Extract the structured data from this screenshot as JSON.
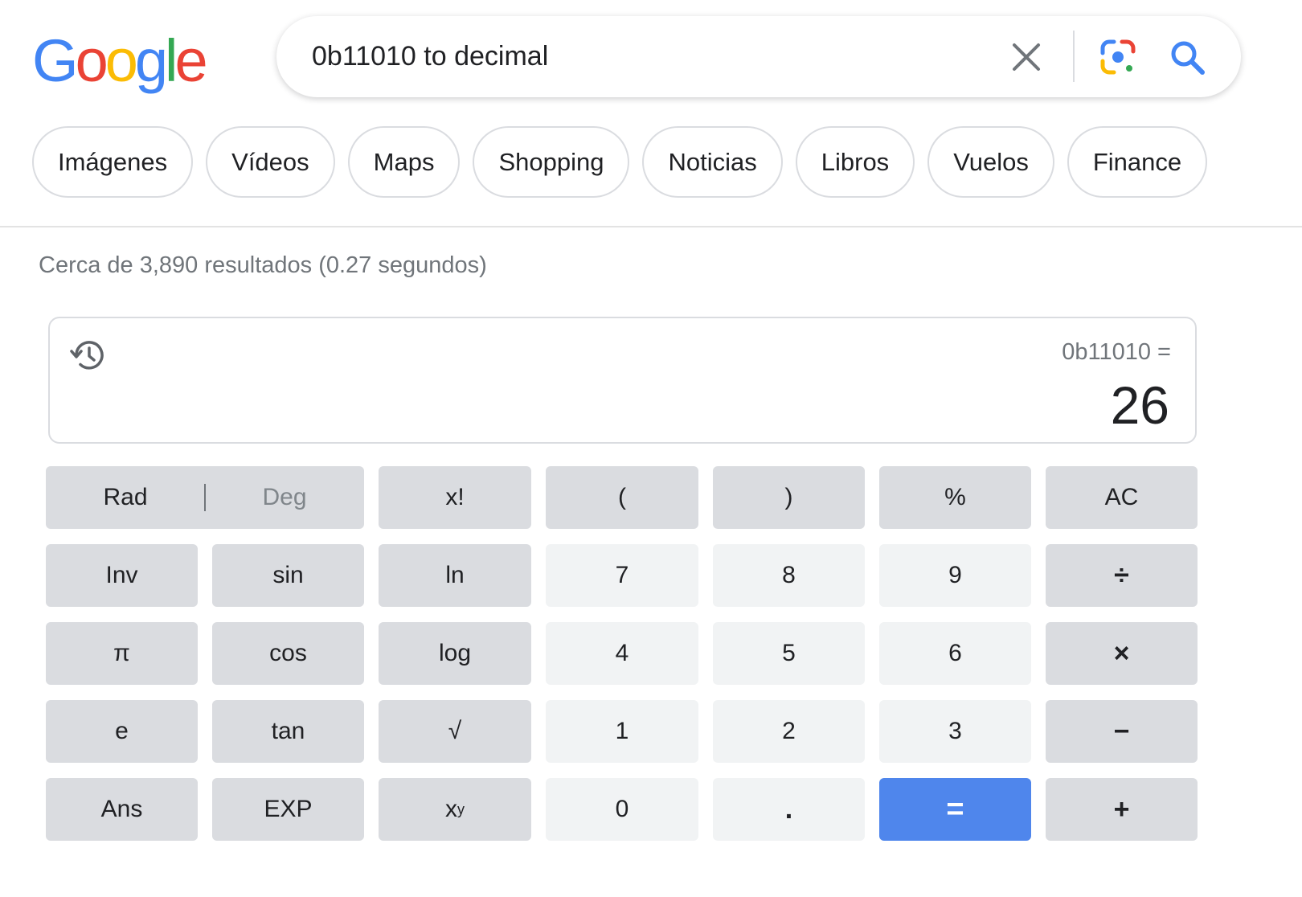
{
  "logo": {
    "text": "Google",
    "letters": [
      {
        "ch": "G",
        "color": "#4285F4"
      },
      {
        "ch": "o",
        "color": "#EA4335"
      },
      {
        "ch": "o",
        "color": "#FBBC05"
      },
      {
        "ch": "g",
        "color": "#4285F4"
      },
      {
        "ch": "l",
        "color": "#34A853"
      },
      {
        "ch": "e",
        "color": "#EA4335"
      }
    ]
  },
  "search": {
    "query": "0b11010 to decimal",
    "icons": [
      "close-icon",
      "google-lens-icon",
      "search-icon"
    ]
  },
  "tabs": [
    {
      "label": "Imágenes"
    },
    {
      "label": "Vídeos"
    },
    {
      "label": "Maps"
    },
    {
      "label": "Shopping"
    },
    {
      "label": "Noticias"
    },
    {
      "label": "Libros"
    },
    {
      "label": "Vuelos"
    },
    {
      "label": "Finance"
    }
  ],
  "stats": "Cerca de 3,890 resultados (0.27 segundos)",
  "calculator": {
    "expression": "0b11010 =",
    "result": "26",
    "mode": {
      "rad": "Rad",
      "deg": "Deg",
      "active": "Rad"
    },
    "keys": {
      "fact": "x!",
      "lparen": "(",
      "rparen": ")",
      "percent": "%",
      "ac": "AC",
      "inv": "Inv",
      "sin": "sin",
      "ln": "ln",
      "seven": "7",
      "eight": "8",
      "nine": "9",
      "divide": "÷",
      "pi": "π",
      "cos": "cos",
      "log": "log",
      "four": "4",
      "five": "5",
      "six": "6",
      "multiply": "×",
      "e": "e",
      "tan": "tan",
      "sqrt": "√",
      "one": "1",
      "two": "2",
      "three": "3",
      "minus": "−",
      "ans": "Ans",
      "exp": "EXP",
      "pow_base": "x",
      "pow_exp": "y",
      "zero": "0",
      "dot": ".",
      "equals": "=",
      "plus": "+"
    },
    "colors": {
      "equals_bg": "#4f86ec",
      "func_bg": "#dadce0",
      "digit_bg": "#f1f3f4"
    }
  }
}
